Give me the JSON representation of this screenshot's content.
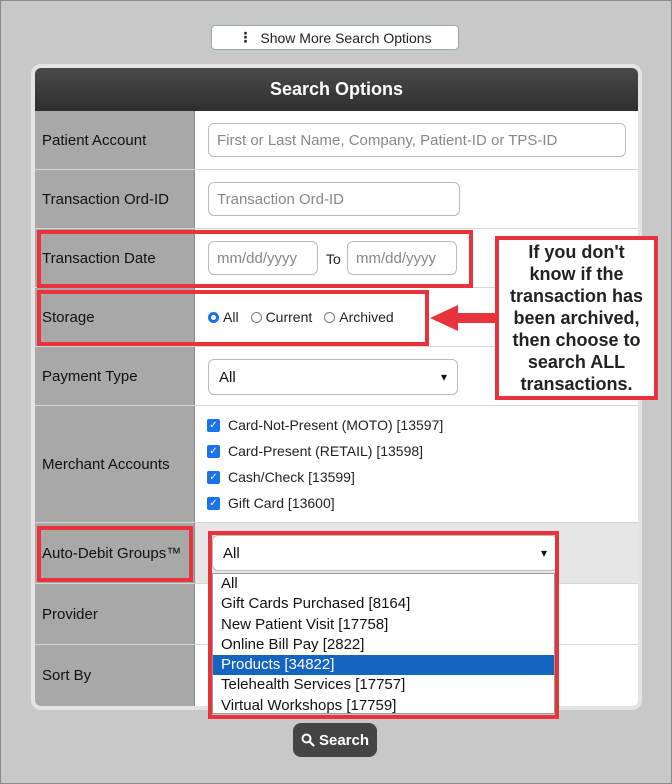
{
  "top": {
    "show_more_label": "Show More Search Options"
  },
  "panel": {
    "title": "Search Options"
  },
  "rows": {
    "patient_account": {
      "label": "Patient Account",
      "placeholder": "First or Last Name, Company, Patient-ID or TPS-ID"
    },
    "transaction_ord_id": {
      "label": "Transaction Ord-ID",
      "placeholder": "Transaction Ord-ID"
    },
    "transaction_date": {
      "label": "Transaction Date",
      "from_placeholder": "mm/dd/yyyy",
      "to_label": "To",
      "to_placeholder": "mm/dd/yyyy"
    },
    "storage": {
      "label": "Storage",
      "options": [
        "All",
        "Current",
        "Archived"
      ],
      "selected": "All"
    },
    "payment_type": {
      "label": "Payment Type",
      "value": "All"
    },
    "merchant_accounts": {
      "label": "Merchant Accounts",
      "items": [
        "Card-Not-Present (MOTO) [13597]",
        "Card-Present (RETAIL) [13598]",
        "Cash/Check [13599]",
        "Gift Card [13600]"
      ]
    },
    "auto_debit_groups": {
      "label": "Auto-Debit Groups™",
      "value": "All"
    },
    "provider": {
      "label": "Provider"
    },
    "sort_by": {
      "label": "Sort By"
    }
  },
  "dropdown": {
    "options": [
      "All",
      "Gift Cards Purchased [8164]",
      "New Patient Visit [17758]",
      "Online Bill Pay [2822]",
      "Products [34822]",
      "Telehealth Services [17757]",
      "Virtual Workshops [17759]"
    ],
    "highlighted": "Products [34822]"
  },
  "callout": {
    "text": "If you don't know if the transaction has been archived, then choose to search ALL transactions."
  },
  "search_button": {
    "label": "Search"
  },
  "colors": {
    "annotation_red": "#e8323c",
    "accent_blue": "#1a73e8",
    "header_dark": "#333333"
  },
  "icons": {
    "dots": "vertical-dots-icon",
    "search": "magnifier-icon",
    "checkbox": "checkmark-icon",
    "chevron": "chevron-down-icon",
    "arrow": "left-arrow-icon"
  }
}
